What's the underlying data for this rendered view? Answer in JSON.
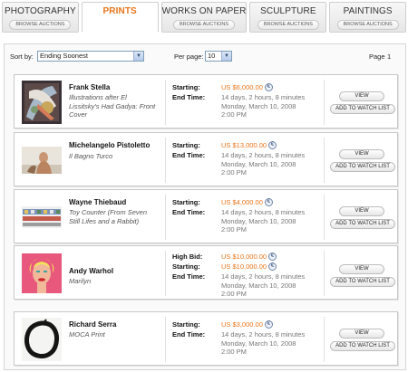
{
  "tabs": [
    {
      "label": "PHOTOGRAPHY",
      "sub": "BROWSE AUCTIONS",
      "active": false
    },
    {
      "label": "PRINTS",
      "sub": "",
      "active": true
    },
    {
      "label": "WORKS ON PAPER",
      "sub": "BROWSE AUCTIONS",
      "active": false
    },
    {
      "label": "SCULPTURE",
      "sub": "BROWSE AUCTIONS",
      "active": false
    },
    {
      "label": "PAINTINGS",
      "sub": "BROWSE AUCTIONS",
      "active": false
    }
  ],
  "toolbar": {
    "sort_label": "Sort by:",
    "sort_value": "Ending Soonest",
    "per_page_label": "Per page:",
    "per_page_value": "10",
    "page_label": "Page",
    "page_number": "1"
  },
  "labels": {
    "starting": "Starting:",
    "high_bid": "High Bid:",
    "end_time": "End Time:",
    "view": "VIEW",
    "watch": "ADD TO WATCH LIST",
    "currency_symbol": "€"
  },
  "lots": [
    {
      "artist": "Frank Stella",
      "title": "Illustrations after El Lissitsky's Had Gadya: Front Cover",
      "high_bid": "",
      "starting": "US $6,000.00",
      "remaining": "14 days, 2 hours, 8 minutes",
      "end_date": "Monday, March 10, 2008",
      "end_clock": "2:00 PM",
      "thumb_icon": "abstract-collage-thumbnail"
    },
    {
      "artist": "Michelangelo Pistoletto",
      "title": "Il Bagno Turco",
      "high_bid": "",
      "starting": "US $13,000.00",
      "remaining": "14 days, 2 hours, 8 minutes",
      "end_date": "Monday, March 10, 2008",
      "end_clock": "2:00 PM",
      "thumb_icon": "figure-thumbnail"
    },
    {
      "artist": "Wayne Thiebaud",
      "title": "Toy Counter (From Seven Still Lifes and a Rabbit)",
      "high_bid": "",
      "starting": "US $4,000.00",
      "remaining": "14 days, 2 hours, 8 minutes",
      "end_date": "Monday, March 10, 2008",
      "end_clock": "2:00 PM",
      "thumb_icon": "toy-counter-thumbnail"
    },
    {
      "artist": "Andy Warhol",
      "title": "Marilyn",
      "high_bid": "US $10,000.00",
      "starting": "US $10,000.00",
      "remaining": "14 days, 2 hours, 8 minutes",
      "end_date": "Monday, March 10, 2008",
      "end_clock": "2:00 PM",
      "thumb_icon": "marilyn-portrait-thumbnail"
    },
    {
      "artist": "Richard Serra",
      "title": "MOCA Print",
      "high_bid": "",
      "starting": "US $3,000.00",
      "remaining": "14 days, 2 hours, 8 minutes",
      "end_date": "Monday, March 10, 2008",
      "end_clock": "2:00 PM",
      "thumb_icon": "black-circle-thumbnail"
    }
  ],
  "colors": {
    "accent": "#e8741a",
    "border": "#c8c8c8",
    "muted": "#777777"
  }
}
